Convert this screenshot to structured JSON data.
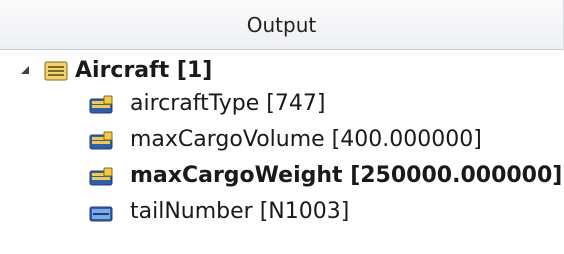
{
  "header": {
    "title": "Output"
  },
  "tree": {
    "root": {
      "label": "Aircraft [1]",
      "icon": "class-icon"
    },
    "children": [
      {
        "label": "aircraftType [747]",
        "icon": "attribute-icon",
        "bold": false
      },
      {
        "label": "maxCargoVolume [400.000000]",
        "icon": "attribute-icon",
        "bold": false
      },
      {
        "label": "maxCargoWeight [250000.000000]",
        "icon": "attribute-icon",
        "bold": true
      },
      {
        "label": "tailNumber [N1003]",
        "icon": "string-attribute-icon",
        "bold": false
      }
    ]
  },
  "colors": {
    "header_border": "#c9ced6",
    "icon_yellow": "#f2c94c",
    "icon_blue": "#2f5fa8",
    "text": "#1a1a1a"
  }
}
